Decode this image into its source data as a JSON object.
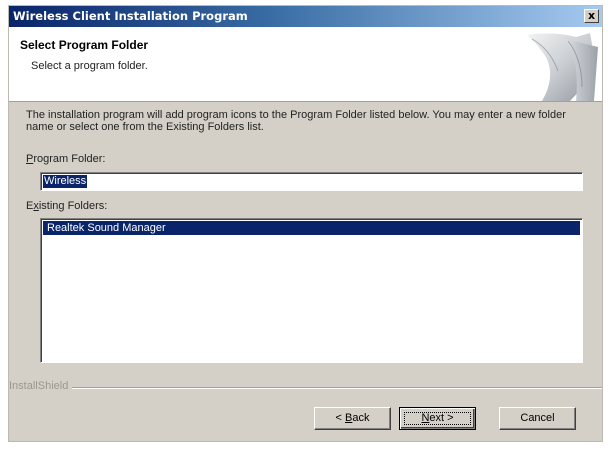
{
  "window": {
    "title": "Wireless Client Installation Program",
    "close_glyph": "x"
  },
  "header": {
    "title": "Select Program Folder",
    "subtitle": "Select a program folder."
  },
  "description": "The installation program will add program icons to the Program Folder listed below. You may enter a new folder name or select one from the Existing Folders list.",
  "program_folder": {
    "label_prefix": "",
    "label_accel": "P",
    "label_rest": "rogram Folder:",
    "value": "Wireless"
  },
  "existing_folders": {
    "label_prefix": "E",
    "label_accel": "x",
    "label_rest": "isting Folders:",
    "items": [
      "Realtek Sound Manager"
    ],
    "selected_index": 0
  },
  "brand": "InstallShield",
  "buttons": {
    "back": {
      "prefix": "< ",
      "accel": "B",
      "rest": "ack"
    },
    "next": {
      "prefix": "",
      "accel": "N",
      "rest": "ext >"
    },
    "cancel": {
      "label": "Cancel"
    }
  },
  "colors": {
    "title_bar": "#0a246a",
    "selection": "#0a246a",
    "dialog_face": "#d4d0c8"
  }
}
